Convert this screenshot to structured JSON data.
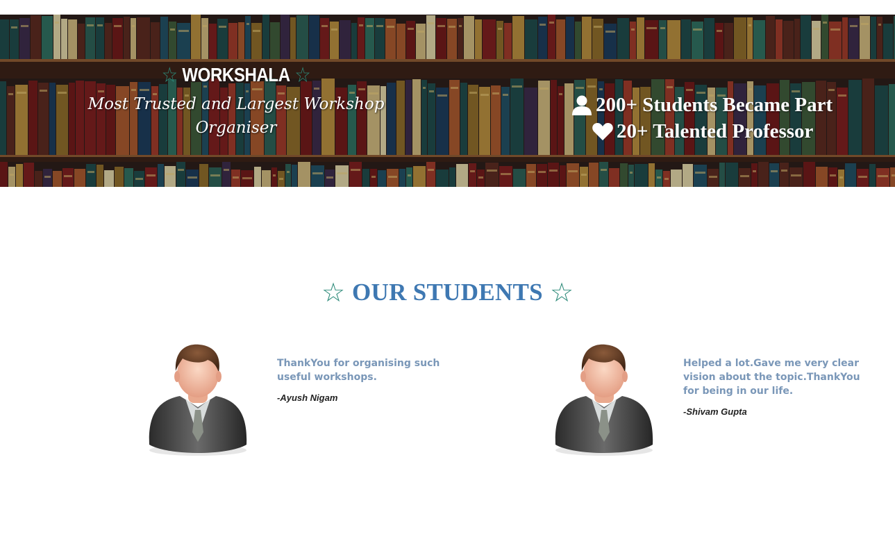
{
  "hero": {
    "brand_title": "WORKSHALA",
    "tagline": "Most Trusted and Largest Workshop Organiser",
    "stats": [
      {
        "icon": "user-icon",
        "text": "200+ Students Became Part"
      },
      {
        "icon": "heart-icon",
        "text": "20+ Talented Professor"
      }
    ]
  },
  "students_section": {
    "title": "OUR STUDENTS",
    "testimonials": [
      {
        "quote": "ThankYou for organising such useful workshops.",
        "author": "-Ayush Nigam",
        "avatar_icon": "student-avatar-icon"
      },
      {
        "quote": "Helped a lot.Gave me very clear vision about the topic.ThankYou for being in our life.",
        "author": "-Shivam Gupta",
        "avatar_icon": "student-avatar-icon"
      }
    ]
  },
  "colors": {
    "star_teal": "#2e8b7a",
    "title_blue": "#3e78b2",
    "quote_blue": "#7a97b8"
  }
}
